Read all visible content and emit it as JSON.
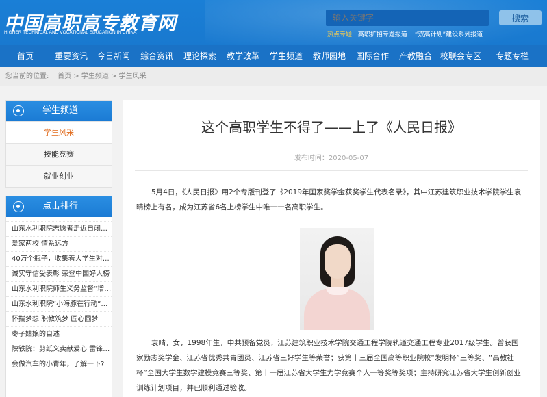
{
  "header": {
    "logo_cn": "中国高职高专教育网",
    "logo_en": "HIGHER TECHNICAL AND VOCATIONAL EDUCATION IN CHINA",
    "search_placeholder": "输入关键字",
    "search_button": "搜索",
    "hot_label": "热点专题:",
    "hot_links": [
      "高职扩招专题报道",
      "“双高计划”建设系列报道"
    ]
  },
  "nav": {
    "items": [
      "首页",
      "重要资讯",
      "今日新闻",
      "综合资讯",
      "理论探索",
      "教学改革",
      "学生频道",
      "教师园地",
      "国际合作",
      "产教融合",
      "校联会专区",
      "专题专栏"
    ]
  },
  "breadcrumb": {
    "label": "您当前的位置:",
    "items": [
      "首页",
      "学生频道",
      "学生风采"
    ],
    "sep": ">"
  },
  "sidebar": {
    "channel": {
      "title": "学生频道",
      "items": [
        "学生风采",
        "技能竞赛",
        "就业创业"
      ]
    },
    "ranking": {
      "title": "点击排行",
      "items": [
        "山东水利职院志愿者走近自闭症...",
        "爱家两校 情系远方",
        "40万个瓶子，收集着大学生对留...",
        "诚实守信受表彰 荣登中国好人榜",
        "山东水利职院师生义务监督“增殖...",
        "山东水利职院“小海豚在行动”接...",
        "怀揣梦想 职教筑梦 匠心圆梦",
        "枣子姑娘的自述",
        "陕铁院：剪纸义卖献爱心 雷锋精...",
        "会做汽车的小青年，了解一下?"
      ]
    }
  },
  "article": {
    "title": "这个高职学生不得了——上了《人民日报》",
    "meta": "发布时间：2020-05-07",
    "paragraph1": "5月4日，《人民日报》用2个专版刊登了《2019年国家奖学金获奖学生代表名录》，其中江苏建筑职业技术学院学生袁晴榜上有名，成为江苏省6名上榜学生中唯一一名高职学生。",
    "paragraph2": "袁晴，女，1998年生，中共预备党员，江苏建筑职业技术学院交通工程学院轨道交通工程专业2017级学生。曾获国家励志奖学金、江苏省优秀共青团员、江苏省三好学生等荣誉；获第十三届全国高等职业院校“发明杯”三等奖、“高教社杯”全国大学生数学建模竞赛三等奖、第十一届江苏省大学生力学竞赛个人一等奖等奖项；主持研究江苏省大学生创新创业训练计划项目，并已顺利通过验收。"
  }
}
